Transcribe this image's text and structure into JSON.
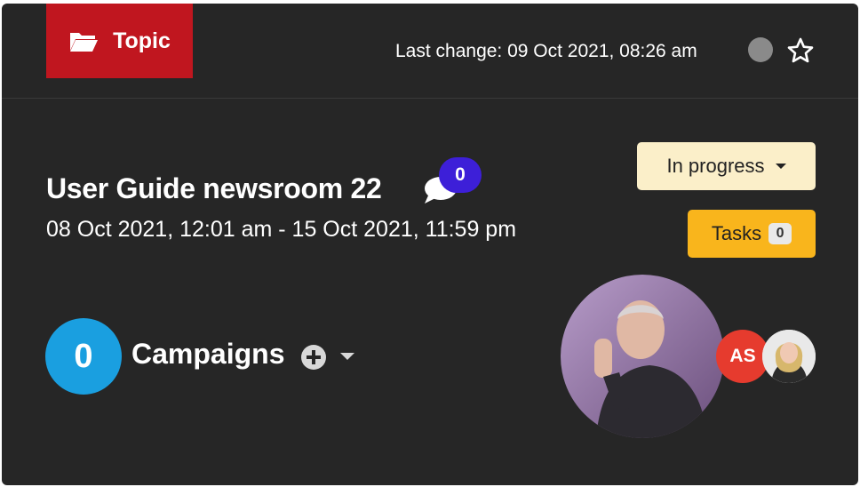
{
  "header": {
    "tag_label": "Topic",
    "tag_icon": "folder-open-icon",
    "tag_color": "#c0161f",
    "last_change": "Last change: 09 Oct 2021, 08:26 am",
    "status_dot_color": "#8a8a8a",
    "favorite_icon": "star-outline-icon"
  },
  "topic": {
    "title": "User Guide newsroom 22",
    "comment_count": "0",
    "date_range": "08 Oct 2021, 12:01 am - 15 Oct 2021, 11:59 pm"
  },
  "status": {
    "label": "In progress",
    "color": "#fbefc9"
  },
  "tasks": {
    "label": "Tasks",
    "count": "0",
    "color": "#f9b51c"
  },
  "campaigns": {
    "count": "0",
    "label": "Campaigns",
    "count_color": "#1a9fe0"
  },
  "team": {
    "initials": "AS"
  }
}
